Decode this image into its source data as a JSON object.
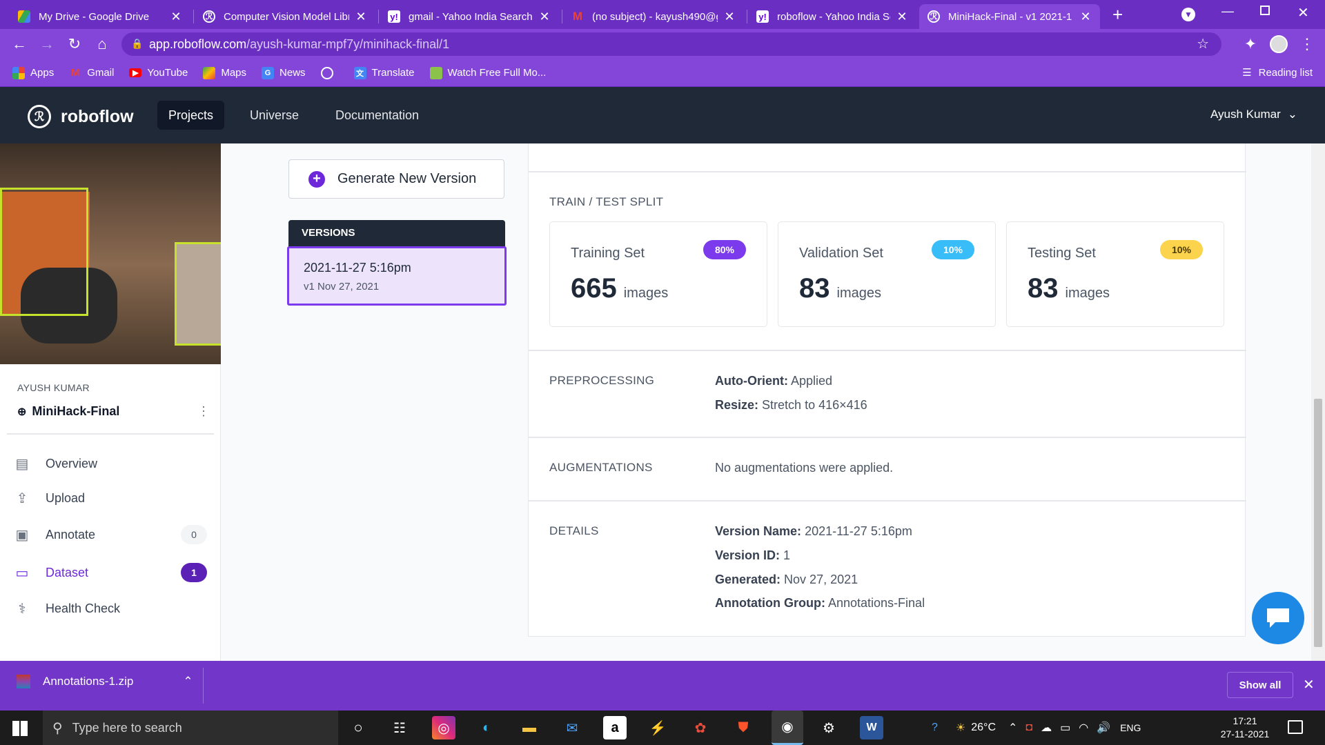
{
  "browser": {
    "tabs": [
      {
        "title": "My Drive - Google Drive",
        "icon": "google-drive-icon"
      },
      {
        "title": "Computer Vision Model Libr",
        "icon": "roboflow-icon"
      },
      {
        "title": "gmail - Yahoo India Search",
        "icon": "yahoo-icon"
      },
      {
        "title": "(no subject) - kayush490@g",
        "icon": "gmail-icon"
      },
      {
        "title": "roboflow - Yahoo India Sear",
        "icon": "yahoo-icon"
      },
      {
        "title": "MiniHack-Final - v1 2021-1",
        "icon": "roboflow-icon",
        "active": true
      }
    ],
    "url_domain": "app.roboflow.com",
    "url_path": "/ayush-kumar-mpf7y/minihack-final/1",
    "bookmarks": [
      "Apps",
      "Gmail",
      "YouTube",
      "Maps",
      "News",
      "",
      "Translate",
      "Watch Free Full Mo..."
    ],
    "reading_list": "Reading list"
  },
  "appnav": {
    "brand": "roboflow",
    "links": [
      "Projects",
      "Universe",
      "Documentation"
    ],
    "user": "Ayush Kumar"
  },
  "sidebar": {
    "owner": "AYUSH KUMAR",
    "project": "MiniHack-Final",
    "items": [
      {
        "label": "Overview",
        "icon": "document-icon"
      },
      {
        "label": "Upload",
        "icon": "upload-icon"
      },
      {
        "label": "Annotate",
        "icon": "image-icon",
        "badge": "0"
      },
      {
        "label": "Dataset",
        "icon": "folder-icon",
        "badge": "1",
        "active": true
      },
      {
        "label": "Health Check",
        "icon": "stethoscope-icon"
      }
    ]
  },
  "versions": {
    "generate_label": "Generate New Version",
    "header": "VERSIONS",
    "items": [
      {
        "name": "2021-11-27 5:16pm",
        "sub": "v1 Nov 27, 2021"
      }
    ]
  },
  "split": {
    "label": "TRAIN / TEST SPLIT",
    "sets": [
      {
        "name": "Training Set",
        "pct": "80%",
        "count": "665",
        "unit": "images",
        "color": "#7c3aed"
      },
      {
        "name": "Validation Set",
        "pct": "10%",
        "count": "83",
        "unit": "images",
        "color": "#38bdf8"
      },
      {
        "name": "Testing Set",
        "pct": "10%",
        "count": "83",
        "unit": "images",
        "color": "#fcd34d"
      }
    ]
  },
  "preprocessing": {
    "label": "PREPROCESSING",
    "rows": [
      {
        "k": "Auto-Orient:",
        "v": "Applied"
      },
      {
        "k": "Resize:",
        "v": "Stretch to 416×416"
      }
    ]
  },
  "augmentations": {
    "label": "AUGMENTATIONS",
    "text": "No augmentations were applied."
  },
  "details": {
    "label": "DETAILS",
    "rows": [
      {
        "k": "Version Name:",
        "v": "2021-11-27 5:16pm"
      },
      {
        "k": "Version ID:",
        "v": "1"
      },
      {
        "k": "Generated:",
        "v": "Nov 27, 2021"
      },
      {
        "k": "Annotation Group:",
        "v": "Annotations-Final"
      }
    ]
  },
  "download": {
    "file": "Annotations-1.zip",
    "show_all": "Show all"
  },
  "taskbar": {
    "search_placeholder": "Type here to search",
    "temp": "26°C",
    "lang": "ENG",
    "time": "17:21",
    "date": "27-11-2021"
  }
}
